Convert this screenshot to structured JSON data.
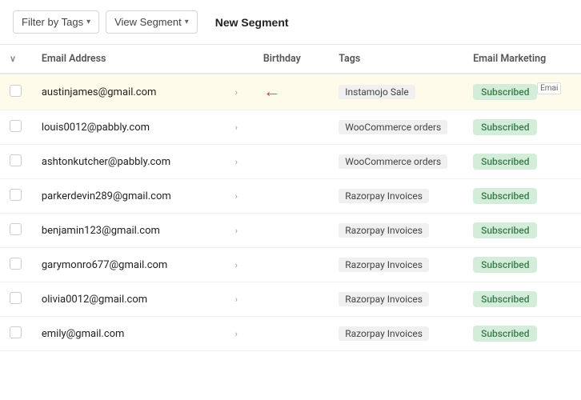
{
  "toolbar": {
    "filter_label": "Filter by Tags",
    "view_label": "View Segment",
    "new_segment_label": "New Segment"
  },
  "table": {
    "columns": {
      "email": "Email Address",
      "birthday": "Birthday",
      "tags": "Tags",
      "marketing": "Email Marketing"
    },
    "rows": [
      {
        "email": "austinjames@gmail.com",
        "birthday": "",
        "tag": "Instamojo Sale",
        "marketing": "Subscribed",
        "highlighted": true,
        "has_arrow": true
      },
      {
        "email": "louis0012@pabbly.com",
        "birthday": "",
        "tag": "WooCommerce orders",
        "marketing": "Subscribed",
        "highlighted": false,
        "has_arrow": false
      },
      {
        "email": "ashtonkutcher@pabbly.com",
        "birthday": "",
        "tag": "WooCommerce orders",
        "marketing": "Subscribed",
        "highlighted": false,
        "has_arrow": false
      },
      {
        "email": "parkerdevin289@gmail.com",
        "birthday": "",
        "tag": "Razorpay Invoices",
        "marketing": "Subscribed",
        "highlighted": false,
        "has_arrow": false
      },
      {
        "email": "benjamin123@gmail.com",
        "birthday": "",
        "tag": "Razorpay Invoices",
        "marketing": "Subscribed",
        "highlighted": false,
        "has_arrow": false
      },
      {
        "email": "garymonro677@gmail.com",
        "birthday": "",
        "tag": "Razorpay Invoices",
        "marketing": "Subscribed",
        "highlighted": false,
        "has_arrow": false
      },
      {
        "email": "olivia0012@gmail.com",
        "birthday": "",
        "tag": "Razorpay Invoices",
        "marketing": "Subscribed",
        "highlighted": false,
        "has_arrow": false
      },
      {
        "email": "emily@gmail.com",
        "birthday": "",
        "tag": "Razorpay Invoices",
        "marketing": "Subscribed",
        "highlighted": false,
        "has_arrow": false
      }
    ]
  }
}
